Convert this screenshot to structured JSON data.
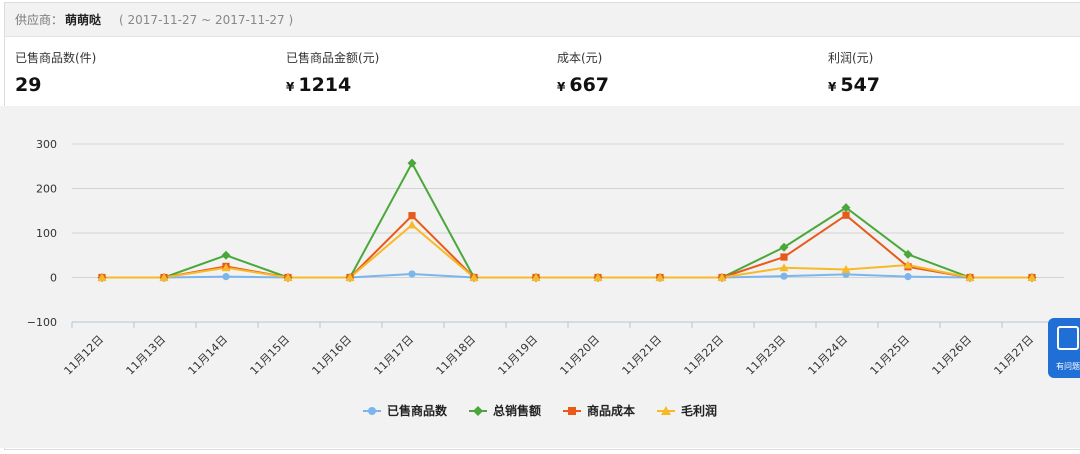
{
  "header": {
    "supplier_label": "供应商：",
    "supplier_name": "萌萌哒",
    "date_range": "( 2017-11-27 ~ 2017-11-27 )"
  },
  "stats": [
    {
      "title": "已售商品数(件)",
      "currency": "",
      "value": "29"
    },
    {
      "title": "已售商品金额(元)",
      "currency": "¥",
      "value": "1214"
    },
    {
      "title": "成本(元)",
      "currency": "¥",
      "value": "667"
    },
    {
      "title": "利润(元)",
      "currency": "¥",
      "value": "547"
    }
  ],
  "help_button": {
    "label": "有问题"
  },
  "colors": {
    "sold": "#7cb5ec",
    "sales": "#4aa83a",
    "cost": "#e8591a",
    "profit": "#f7b928"
  },
  "chart_data": {
    "type": "line",
    "categories": [
      "11月12日",
      "11月13日",
      "11月14日",
      "11月15日",
      "11月16日",
      "11月17日",
      "11月18日",
      "11月19日",
      "11月20日",
      "11月21日",
      "11月22日",
      "11月23日",
      "11月24日",
      "11月25日",
      "11月26日",
      "11月27日"
    ],
    "y_ticks": [
      300,
      200,
      100,
      0,
      -100
    ],
    "ylim": [
      -100,
      300
    ],
    "grid": true,
    "legend_position": "bottom",
    "series": [
      {
        "name": "已售商品数",
        "color": "#7cb5ec",
        "marker": "circle",
        "values": [
          0,
          0,
          2,
          0,
          0,
          8,
          0,
          0,
          0,
          0,
          0,
          3,
          7,
          2,
          0,
          0
        ]
      },
      {
        "name": "总销售额",
        "color": "#4aa83a",
        "marker": "diamond",
        "values": [
          0,
          0,
          50,
          0,
          0,
          257,
          0,
          0,
          0,
          0,
          0,
          68,
          157,
          52,
          0,
          0
        ]
      },
      {
        "name": "商品成本",
        "color": "#e8591a",
        "marker": "square",
        "values": [
          0,
          0,
          25,
          0,
          0,
          139,
          0,
          0,
          0,
          0,
          0,
          46,
          140,
          24,
          0,
          0
        ]
      },
      {
        "name": "毛利润",
        "color": "#f7b928",
        "marker": "triangle",
        "values": [
          0,
          0,
          22,
          0,
          0,
          118,
          0,
          0,
          0,
          0,
          0,
          22,
          18,
          28,
          0,
          0
        ]
      }
    ]
  }
}
